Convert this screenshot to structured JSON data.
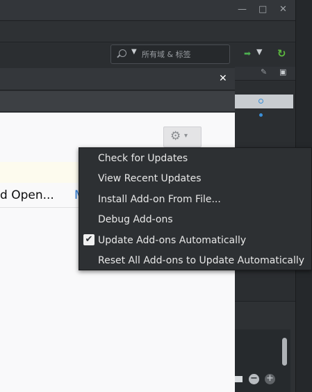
{
  "window_controls": {
    "minimize": "—",
    "maximize": "□",
    "close": "✕"
  },
  "search": {
    "placeholder": "所有域 & 标签"
  },
  "dialog": {
    "close": "✕",
    "open_label": "d Open...",
    "more_label": "M"
  },
  "menu": {
    "items": [
      {
        "label": "Check for Updates"
      },
      {
        "label": "View Recent Updates"
      },
      {
        "label": "Install Add-on From File..."
      },
      {
        "label": "Debug Add-ons"
      },
      {
        "label": "Update Add-ons Automatically",
        "checked": true
      },
      {
        "label": "Reset All Add-ons to Update Automatically"
      }
    ]
  },
  "colors": {
    "accent": "#2a7bd8",
    "menu_bg": "#2d3033",
    "refresh": "#5dbb3f"
  },
  "icons": [
    "search-icon",
    "chevron-down-icon",
    "go-arrow-icon",
    "refresh-icon",
    "pencil-icon",
    "columns-icon",
    "gear-icon",
    "check-icon",
    "close-icon",
    "zoom-in-icon",
    "zoom-out-icon"
  ]
}
